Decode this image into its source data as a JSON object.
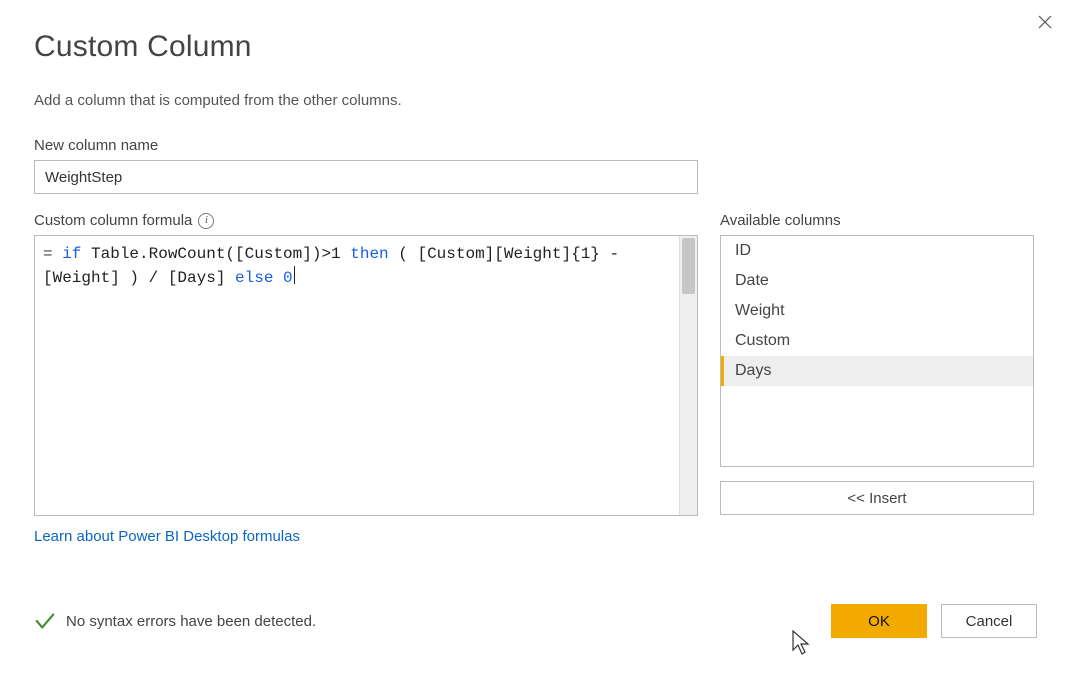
{
  "dialog": {
    "title": "Custom Column",
    "subtitle": "Add a column that is computed from the other columns.",
    "name_label": "New column name",
    "name_value": "WeightStep",
    "formula_label": "Custom column formula",
    "learn_link": "Learn about Power BI Desktop formulas"
  },
  "formula_tokens": {
    "eq": "= ",
    "kw_if": "if",
    "p1": " Table.RowCount([Custom])>1 ",
    "kw_then": "then",
    "p2": " ( [Custom][Weight]{1} - [Weight] ) / [Days] ",
    "kw_else": "else",
    "sp": " ",
    "lit_zero": "0"
  },
  "available": {
    "label": "Available columns",
    "items": [
      "ID",
      "Date",
      "Weight",
      "Custom",
      "Days"
    ],
    "selected_index": 4,
    "insert_label": "<< Insert"
  },
  "status": {
    "text": "No syntax errors have been detected."
  },
  "buttons": {
    "ok": "OK",
    "cancel": "Cancel"
  }
}
